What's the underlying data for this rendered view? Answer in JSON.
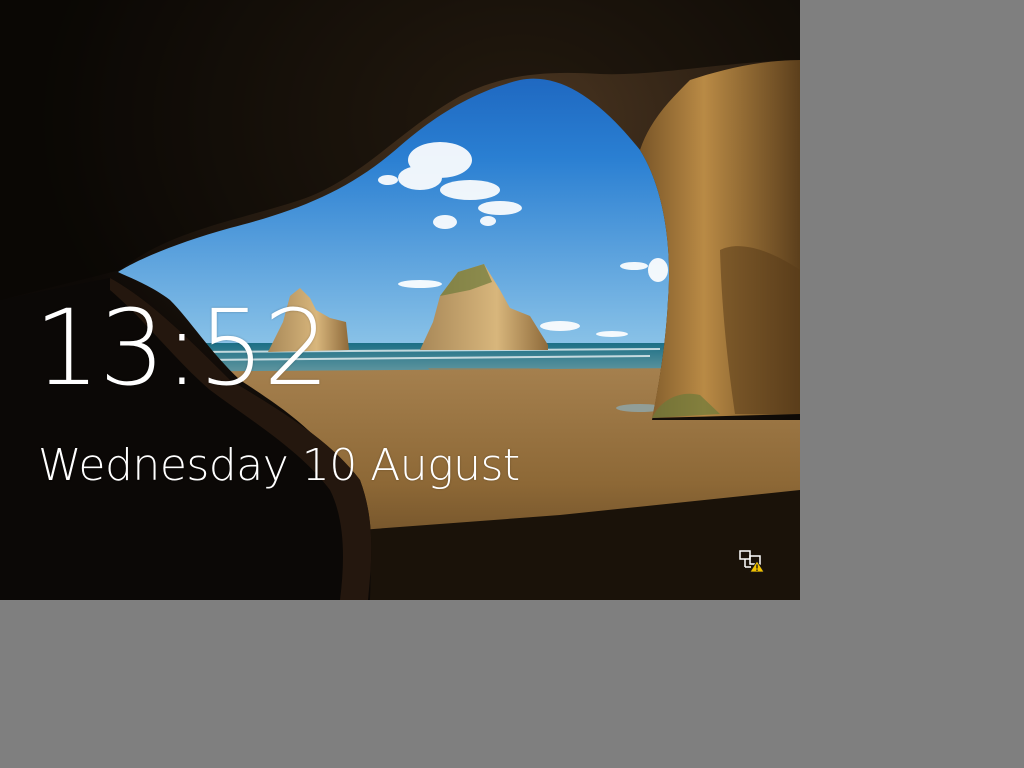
{
  "lock_screen": {
    "time": "13:52",
    "date": "Wednesday 10 August",
    "status_icons": [
      {
        "icon": "network-warning-icon",
        "state": "warning"
      }
    ]
  },
  "colors": {
    "desktop_background": "#7f7f7f",
    "text": "#ffffff",
    "warning": "#f2c200"
  }
}
